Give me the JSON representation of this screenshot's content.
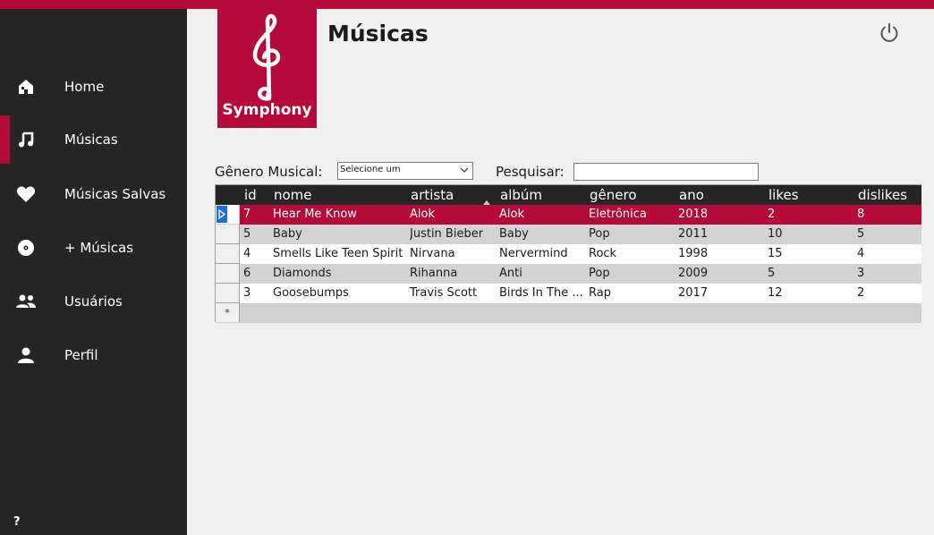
{
  "brand": {
    "name": "Symphony"
  },
  "page": {
    "title": "Músicas"
  },
  "sidebar": {
    "items": [
      {
        "label": "Home",
        "icon": "home-icon"
      },
      {
        "label": "Músicas",
        "icon": "music-note-icon",
        "active": true
      },
      {
        "label": "Músicas Salvas",
        "icon": "heart-icon"
      },
      {
        "label": "+ Músicas",
        "icon": "disc-icon"
      },
      {
        "label": "Usuários",
        "icon": "users-icon"
      },
      {
        "label": "Perfil",
        "icon": "user-icon"
      }
    ],
    "help": "?"
  },
  "filters": {
    "genre_label": "Gênero Musical:",
    "genre_selected": "Selecione um",
    "search_label": "Pesquisar:",
    "search_value": ""
  },
  "table": {
    "columns": [
      "id",
      "nome",
      "artista",
      "albúm",
      "gênero",
      "ano",
      "likes",
      "dislikes"
    ],
    "sorted_column": "artista",
    "rows": [
      {
        "id": "7",
        "nome": "Hear Me Know",
        "artista": "Alok",
        "album": "Alok",
        "genero": "Eletrônica",
        "ano": "2018",
        "likes": "2",
        "dislikes": "8"
      },
      {
        "id": "5",
        "nome": "Baby",
        "artista": "Justin Bieber",
        "album": "Baby",
        "genero": "Pop",
        "ano": "2011",
        "likes": "10",
        "dislikes": "5"
      },
      {
        "id": "4",
        "nome": "Smells Like Teen Spirit",
        "artista": "Nirvana",
        "album": "Nervermind",
        "genero": "Rock",
        "ano": "1998",
        "likes": "15",
        "dislikes": "4"
      },
      {
        "id": "6",
        "nome": "Diamonds",
        "artista": "Rihanna",
        "album": "Anti",
        "genero": "Pop",
        "ano": "2009",
        "likes": "5",
        "dislikes": "3"
      },
      {
        "id": "3",
        "nome": "Goosebumps",
        "artista": "Travis Scott",
        "album": "Birds In The ...",
        "genero": "Rap",
        "ano": "2017",
        "likes": "12",
        "dislikes": "2"
      }
    ],
    "new_row_marker": "*"
  },
  "colors": {
    "accent": "#b5093a",
    "sidebar": "#252526",
    "background": "#f0f0f0"
  }
}
